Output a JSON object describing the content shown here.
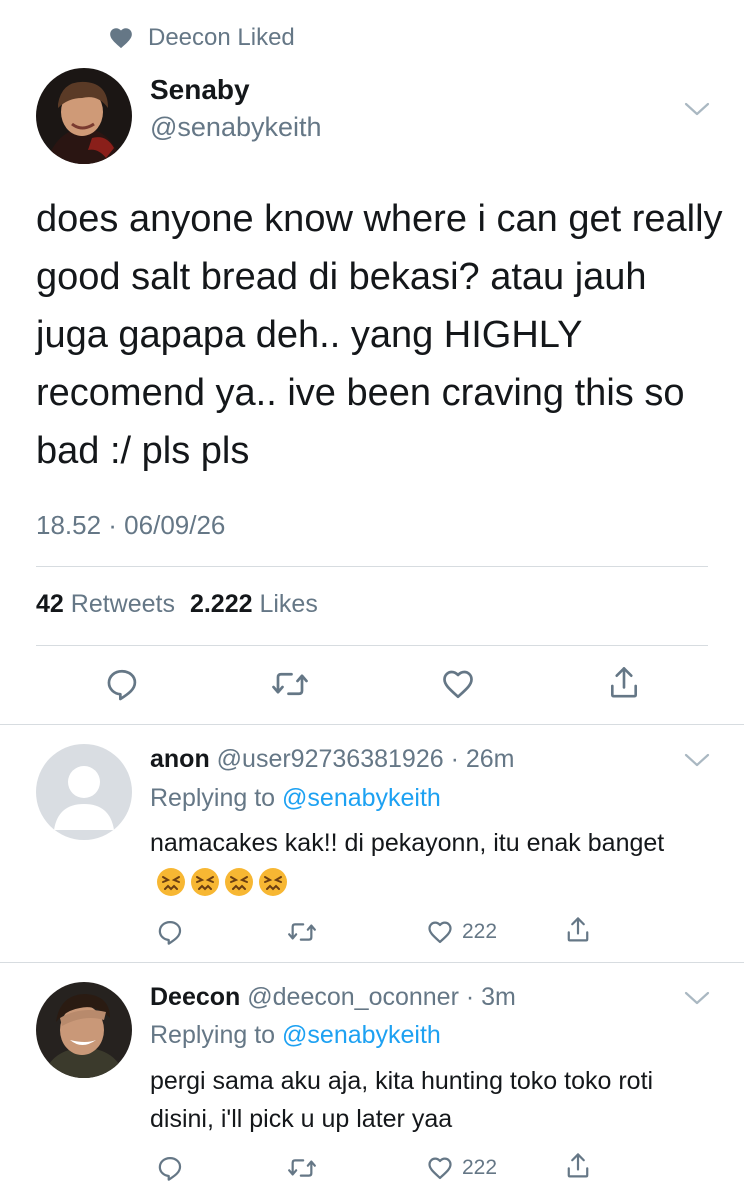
{
  "context": {
    "liked_text": "Deecon Liked"
  },
  "tweet": {
    "author_name": "Senaby",
    "author_handle": "@senabykeith",
    "text": "does anyone know where i can get really good salt bread di bekasi? atau jauh juga gapapa deh.. yang HIGHLY recomend ya.. ive been craving this so bad :/ pls pls",
    "timestamp": "18.52 · 06/09/26",
    "retweets_count": "42",
    "retweets_label": "Retweets",
    "likes_count": "2.222",
    "likes_label": "Likes"
  },
  "replies": [
    {
      "name": "anon",
      "handle": "@user92736381926",
      "time": "· 26m",
      "replying_label": "Replying to",
      "replying_to": "@senabykeith",
      "text": "namacakes kak!! di pekayonn, itu enak banget",
      "emoji": [
        "persevering-face",
        "persevering-face",
        "persevering-face",
        "persevering-face"
      ],
      "likes": "222"
    },
    {
      "name": "Deecon",
      "handle": "@deecon_oconner",
      "time": "· 3m",
      "replying_label": "Replying to",
      "replying_to": "@senabykeith",
      "text": "pergi sama aku aja, kita hunting toko toko roti disini, i'll pick u up later yaa",
      "likes": "222"
    }
  ],
  "colors": {
    "primary_text": "#14171a",
    "secondary_text": "#657786",
    "link": "#1da1f2",
    "divider": "#d7dce0",
    "icon": "#657786"
  }
}
